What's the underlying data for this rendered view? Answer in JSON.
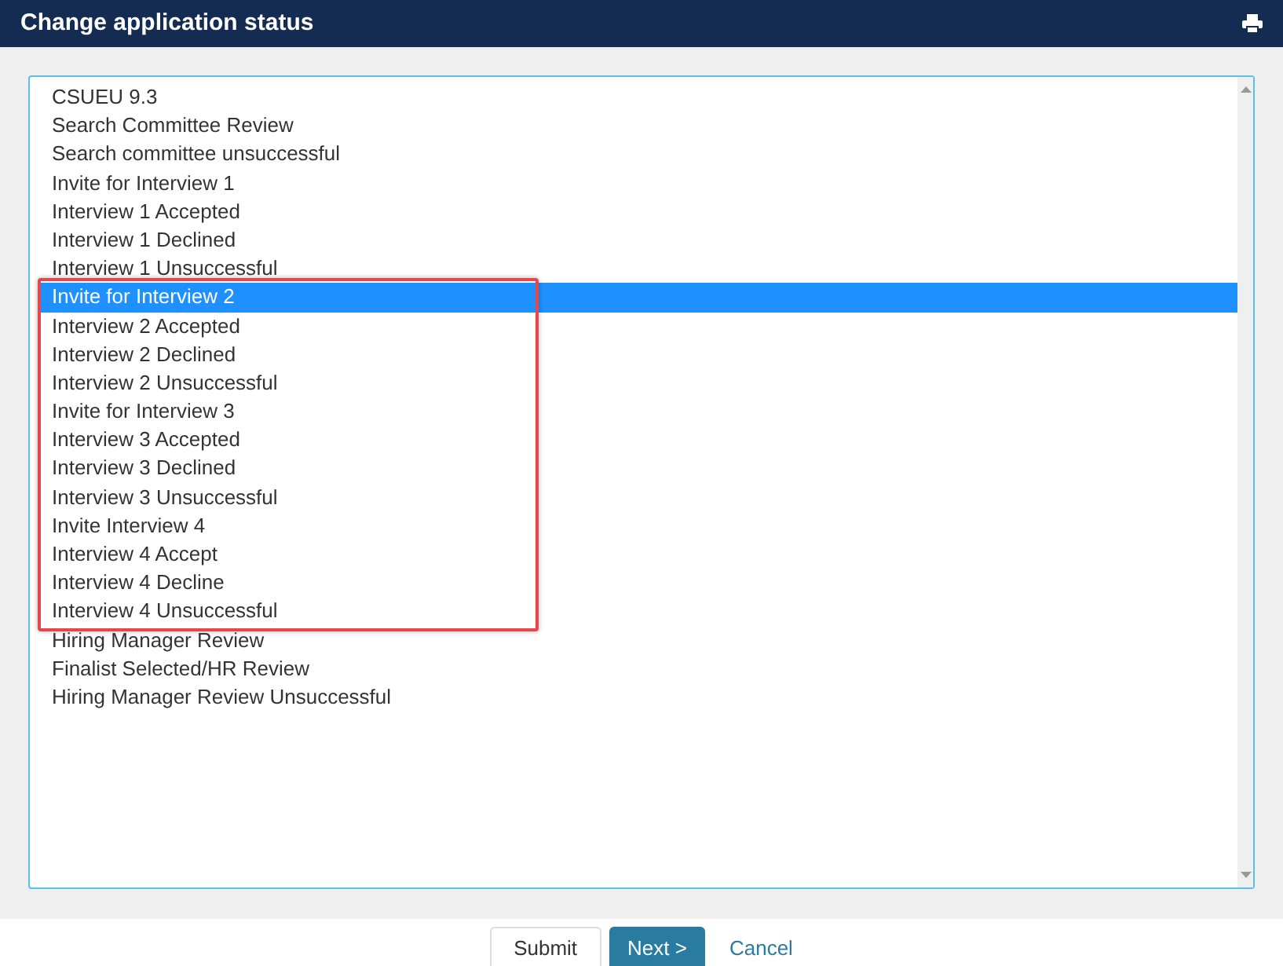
{
  "window": {
    "title": "Change application status"
  },
  "status_groups": [
    {
      "highlighted": false,
      "statuses": [
        {
          "label": "CSUEU 9.3",
          "selected": false
        },
        {
          "label": "Search Committee Review",
          "selected": false
        },
        {
          "label": "Search committee unsuccessful",
          "selected": false
        },
        {
          "label": "Invite for Interview 1",
          "selected": false
        },
        {
          "label": "Interview 1 Accepted",
          "selected": false
        },
        {
          "label": "Interview 1 Declined",
          "selected": false
        },
        {
          "label": "Interview 1 Unsuccessful",
          "selected": false
        }
      ]
    },
    {
      "highlighted": true,
      "statuses": [
        {
          "label": "Invite for Interview 2",
          "selected": true
        },
        {
          "label": "Interview 2 Accepted",
          "selected": false
        },
        {
          "label": "Interview 2 Declined",
          "selected": false
        },
        {
          "label": "Interview 2 Unsuccessful",
          "selected": false
        },
        {
          "label": "Invite for Interview 3",
          "selected": false
        },
        {
          "label": "Interview 3 Accepted",
          "selected": false
        },
        {
          "label": "Interview 3 Declined",
          "selected": false
        },
        {
          "label": "Interview 3 Unsuccessful",
          "selected": false
        },
        {
          "label": "Invite Interview 4",
          "selected": false
        },
        {
          "label": "Interview 4 Accept",
          "selected": false
        },
        {
          "label": "Interview 4 Decline",
          "selected": false
        },
        {
          "label": "Interview 4 Unsuccessful",
          "selected": false
        }
      ]
    },
    {
      "highlighted": false,
      "statuses": [
        {
          "label": "Hiring Manager Review",
          "selected": false
        },
        {
          "label": "Finalist Selected/HR Review",
          "selected": false
        },
        {
          "label": "Hiring Manager Review Unsuccessful",
          "selected": false
        }
      ]
    }
  ],
  "buttons": [
    {
      "label": "Submit",
      "kind": "default"
    },
    {
      "label": "Next >",
      "kind": "primary"
    },
    {
      "label": "Cancel",
      "kind": "link"
    }
  ]
}
